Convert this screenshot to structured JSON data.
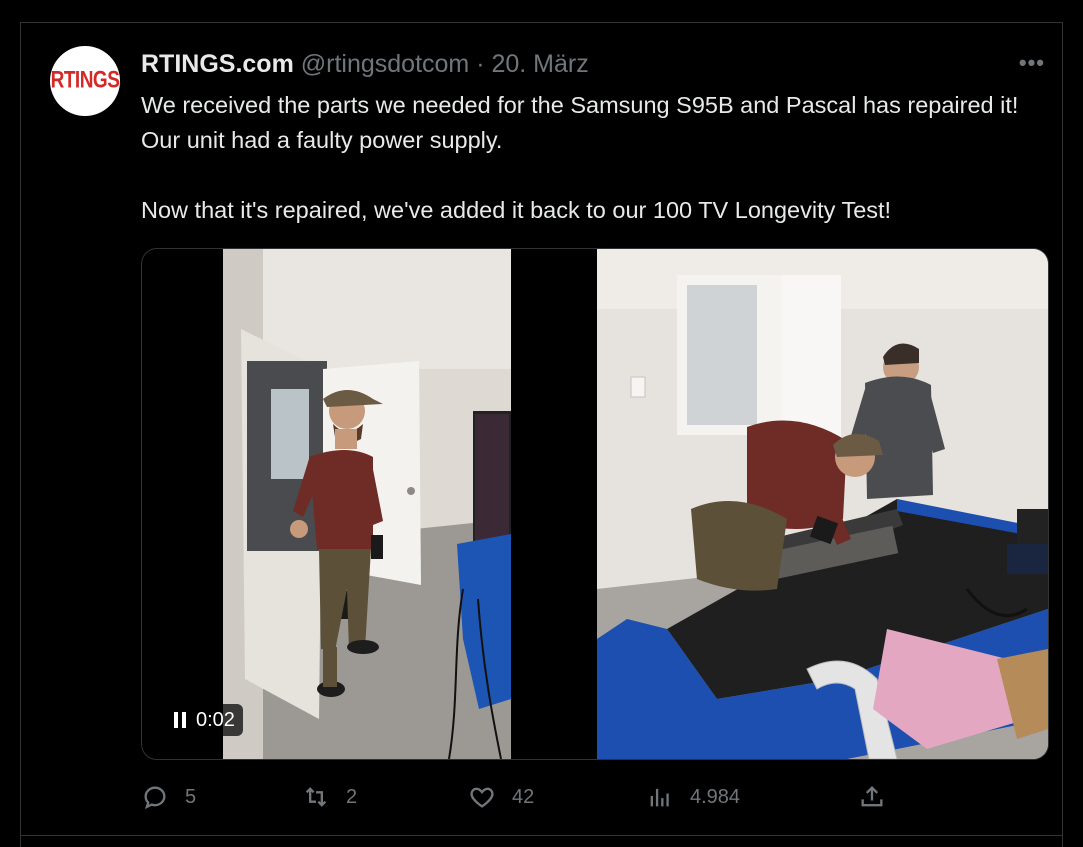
{
  "tweet": {
    "author_name": "RTINGS.com",
    "handle": "@rtingsdotcom",
    "separator": "·",
    "date": "20. März",
    "avatar_text": "RTINGS",
    "more_label": "•••",
    "text": "We received the parts we needed for the Samsung S95B and Pascal has repaired it! Our unit had a faulty power supply.\n\nNow that it's repaired, we've added it back to our 100 TV Longevity Test!"
  },
  "video": {
    "time": "0:02",
    "state_icon": "pause-icon"
  },
  "actions": {
    "replies": "5",
    "retweets": "2",
    "likes": "42",
    "views": "4.984"
  },
  "colors": {
    "background": "#000000",
    "text": "#e7e9ea",
    "muted": "#71767b",
    "border": "#2f3336",
    "logo_red": "#d42a27"
  }
}
